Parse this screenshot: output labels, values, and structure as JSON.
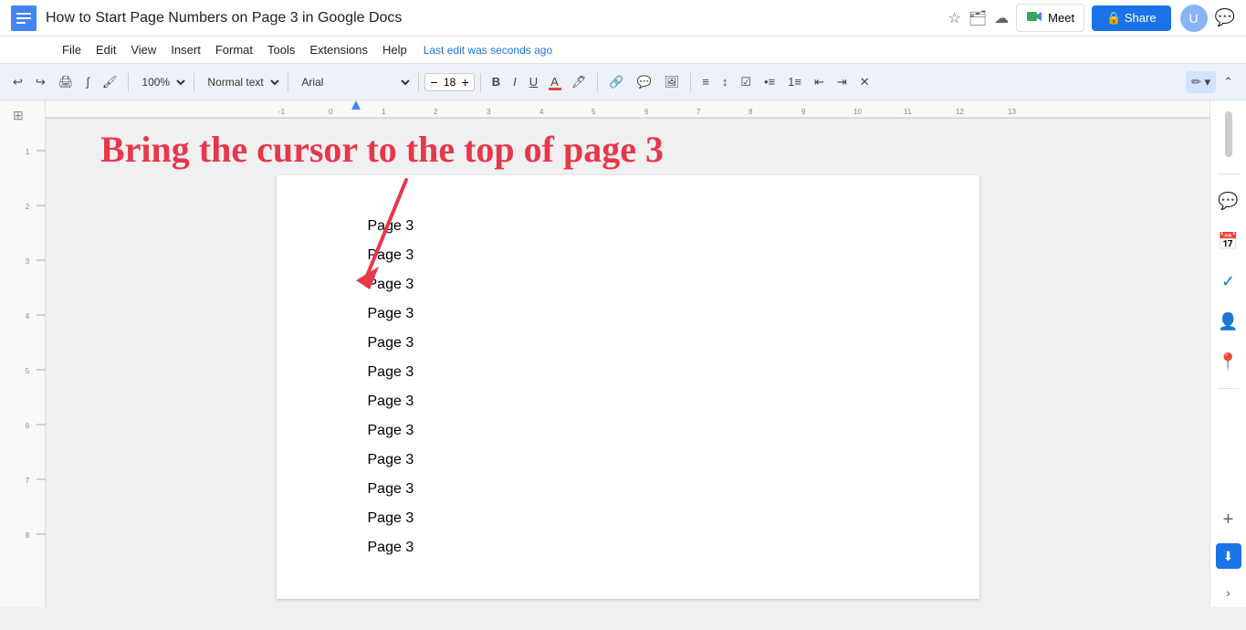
{
  "title_bar": {
    "doc_title": "How to Start Page Numbers on Page 3 in Google Docs",
    "last_edit": "Last edit was seconds ago",
    "share_label": "Share",
    "meet_label": "Meet"
  },
  "menu": {
    "items": [
      "File",
      "Edit",
      "View",
      "Insert",
      "Format",
      "Tools",
      "Extensions",
      "Help"
    ]
  },
  "toolbar": {
    "zoom": "100%",
    "style": "Normal text",
    "font": "Arial",
    "font_size": "18",
    "undo_label": "↩",
    "redo_label": "↪"
  },
  "annotation": {
    "text": "Bring the cursor to the top of page 3"
  },
  "page": {
    "lines": [
      "Page 3",
      "Page 3",
      "Page 3",
      "Page 3",
      "Page 3",
      "Page 3",
      "Page 3",
      "Page 3",
      "Page 3",
      "Page 3",
      "Page 3",
      "Page 3"
    ]
  },
  "sidebar": {
    "icons": [
      "💬",
      "📅",
      "✓",
      "👤",
      "📍"
    ]
  },
  "colors": {
    "annotation": "#e8374a",
    "share_btn": "#1a73e8",
    "toolbar_bg": "#edf2fa"
  }
}
